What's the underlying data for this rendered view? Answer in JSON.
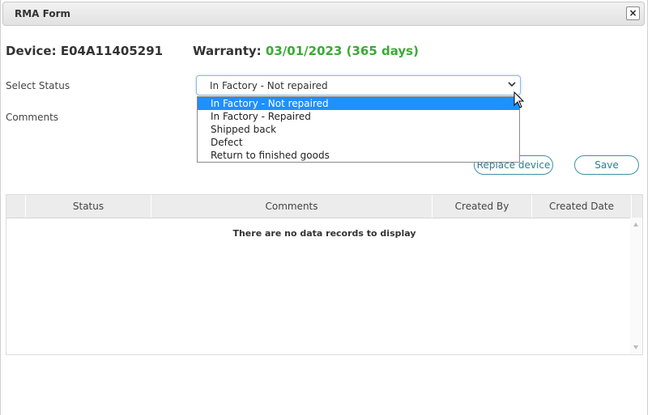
{
  "window": {
    "title": "RMA Form",
    "close_symbol": "×"
  },
  "device": {
    "label": "Device:",
    "value": "E04A11405291"
  },
  "warranty": {
    "label": "Warranty:",
    "value": "03/01/2023 (365 days)",
    "value_color": "#3aaa35"
  },
  "status": {
    "label": "Select Status",
    "selected": "In Factory - Not repaired",
    "options": [
      "In Factory - Not repaired",
      "In Factory - Repaired",
      "Shipped back",
      "Defect",
      "Return to finished goods"
    ]
  },
  "comments": {
    "label": "Comments"
  },
  "buttons": {
    "replace": "Replace device",
    "save": "Save"
  },
  "grid": {
    "columns": [
      "Status",
      "Comments",
      "Created By",
      "Created Date"
    ],
    "empty_message": "There are no data records to display"
  }
}
